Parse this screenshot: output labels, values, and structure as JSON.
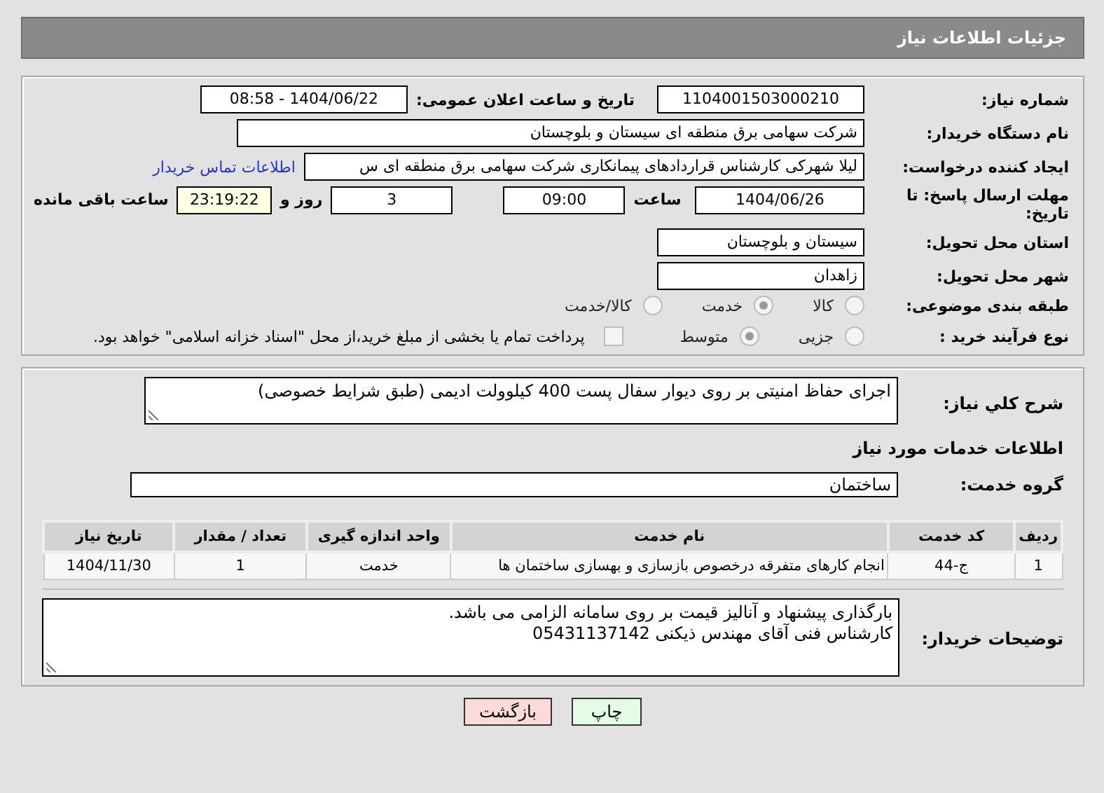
{
  "header": {
    "title": "جزئیات اطلاعات نیاز"
  },
  "details": {
    "need_number": {
      "label": "شماره نیاز:",
      "value": "1104001503000210"
    },
    "announce": {
      "label": "تاریخ و ساعت اعلان عمومی:",
      "value": "1404/06/22 - 08:58"
    },
    "buyer": {
      "label": "نام دستگاه خریدار:",
      "value": "شرکت سهامی برق منطقه ای سیستان و بلوچستان"
    },
    "requester": {
      "label": "ایجاد کننده درخواست:",
      "value": "لیلا شهرکی کارشناس قراردادهای پیمانکاری شرکت سهامی برق منطقه ای س",
      "link": "اطلاعات تماس خریدار"
    },
    "deadline": {
      "label": "مهلت ارسال پاسخ: تا تاریخ:",
      "date": "1404/06/26",
      "time_label": "ساعت",
      "time": "09:00",
      "days": "3",
      "days_label": "روز و",
      "remaining": "23:19:22",
      "remaining_label": "ساعت باقی مانده"
    },
    "province": {
      "label": "استان محل تحویل:",
      "value": "سیستان و بلوچستان"
    },
    "city": {
      "label": "شهر محل تحویل:",
      "value": "زاهدان"
    },
    "category": {
      "label": "طبقه بندی موضوعی:",
      "options": [
        {
          "label": "کالا",
          "selected": false
        },
        {
          "label": "خدمت",
          "selected": true
        },
        {
          "label": "کالا/خدمت",
          "selected": false
        }
      ]
    },
    "process": {
      "label": "نوع فرآیند خرید :",
      "options": [
        {
          "label": "جزیی",
          "selected": false
        },
        {
          "label": "متوسط",
          "selected": true
        }
      ],
      "payment": {
        "label": "پرداخت تمام یا بخشی از مبلغ خرید،از محل \"اسناد خزانه اسلامی\" خواهد بود.",
        "checked": false
      }
    }
  },
  "services": {
    "description": {
      "label": "شرح كلي نياز:",
      "value": "اجرای حفاظ امنیتی بر روی دیوار سفال پست 400 کیلوولت ادیمی (طبق شرایط خصوصی)"
    },
    "section_title": "اطلاعات خدمات مورد نیاز",
    "group": {
      "label": "گروه خدمت:",
      "value": "ساختمان"
    },
    "table": {
      "columns": [
        "ردیف",
        "کد خدمت",
        "نام خدمت",
        "واحد اندازه گیری",
        "تعداد / مقدار",
        "تاریخ نیاز"
      ],
      "rows": [
        [
          "1",
          "ج-44",
          "انجام کارهای متفرقه درخصوص بازسازی و بهسازی ساختمان ها",
          "خدمت",
          "1",
          "1404/11/30"
        ]
      ]
    },
    "notes": {
      "label": "توضیحات خریدار:",
      "lines": [
        "بارگذاری پیشنهاد و آنالیز قیمت بر روی سامانه الزامی می باشد.",
        "کارشناس فنی آقای مهندس ذیکنی 05431137142"
      ]
    }
  },
  "buttons": [
    {
      "label": "چاپ",
      "kind": "print"
    },
    {
      "label": "بازگشت",
      "kind": "back"
    }
  ]
}
